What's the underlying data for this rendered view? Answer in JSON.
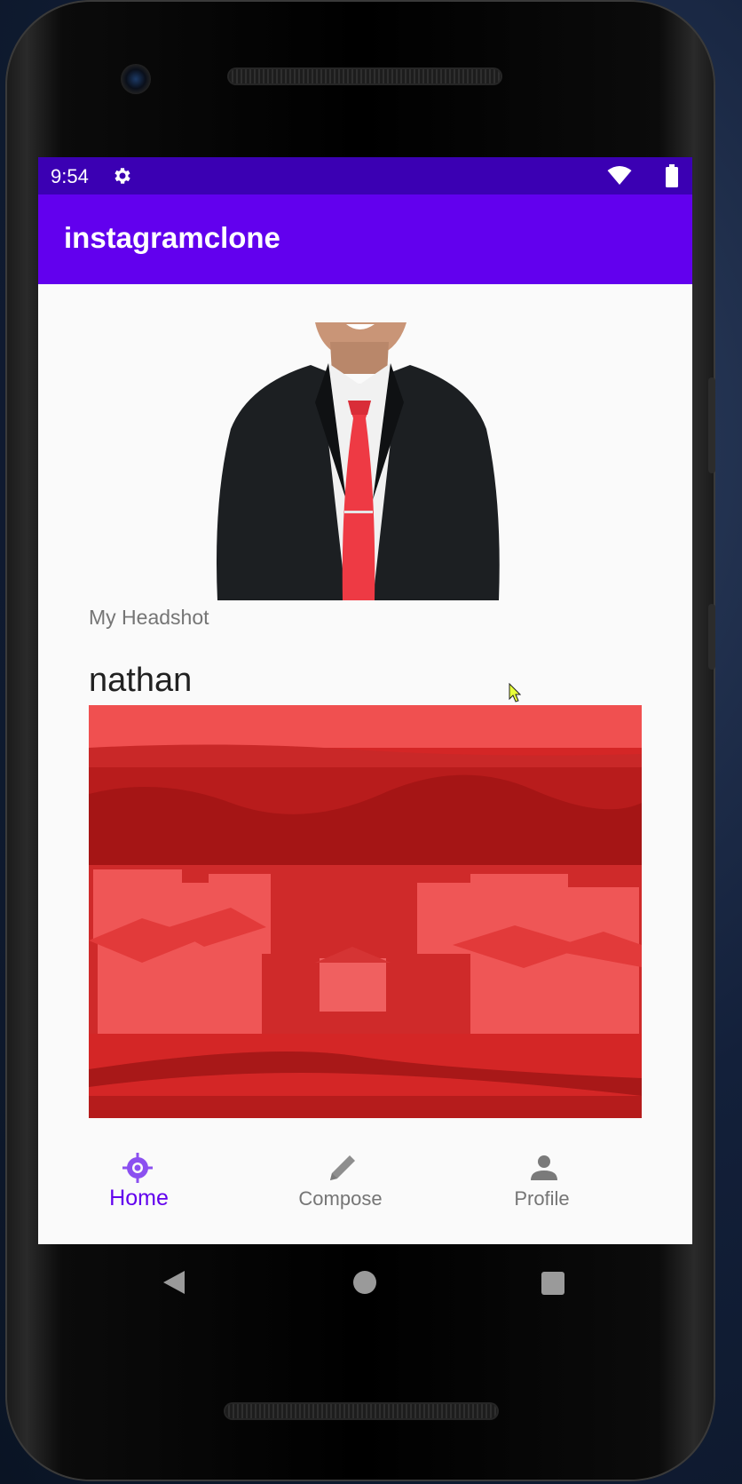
{
  "status_bar": {
    "time": "9:54",
    "icons": [
      "settings-gear-icon",
      "wifi-icon",
      "battery-icon"
    ],
    "color": "#3b00b3"
  },
  "app_bar": {
    "title": "instagramclone",
    "color": "#6200ee"
  },
  "feed": {
    "posts": [
      {
        "image": "headshot-photo",
        "description": "My Headshot"
      },
      {
        "username": "nathan",
        "image": "campus-aerial-photo-red-tint"
      }
    ]
  },
  "bottom_nav": {
    "items": [
      {
        "label": "Home",
        "icon": "home-compass-icon",
        "active": true
      },
      {
        "label": "Compose",
        "icon": "pencil-icon",
        "active": false
      },
      {
        "label": "Profile",
        "icon": "person-icon",
        "active": false
      }
    ],
    "active_color": "#6200ee",
    "inactive_color": "#757575"
  },
  "system_nav": {
    "buttons": [
      "back-triangle-icon",
      "home-circle-icon",
      "recents-square-icon"
    ]
  }
}
